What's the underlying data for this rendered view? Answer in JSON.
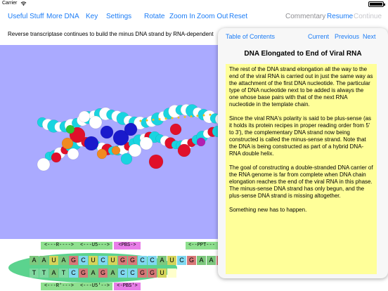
{
  "status": {
    "carrier": "Carrier",
    "time": "",
    "battery": ""
  },
  "toolbar": {
    "useful_stuff": "Useful Stuff",
    "more_dna": "More DNA",
    "key": "Key",
    "settings": "Settings",
    "rotate": "Rotate",
    "zoom_in": "Zoom In",
    "zoom_out": "Zoom Out",
    "reset": "Reset",
    "commentary": "Commentary",
    "resume": "Resume",
    "continue": "Continue"
  },
  "caption": "Reverse transcriptase continues to build the minus DNA strand by RNA-dependent",
  "popover": {
    "nav": {
      "toc": "Table of Contents",
      "current": "Current",
      "previous": "Previous",
      "next": "Next"
    },
    "title": "DNA Elongated to End of Viral RNA",
    "paragraphs": [
      "The rest of the DNA strand elongation all the way to the end of the viral RNA is carried out in just the same way as the attachment of the first DNA nucleotide. The particular type of DNA nucleotide next to be added is always the one whose base pairs with that of the next RNA nucleotide in the template chain.",
      "Since the viral RNA's polarity is said to be plus-sense (as it holds its protein recipes in proper reading order from 5' to 3'), the complementary DNA strand now being constructed is called the minus-sense strand. Note that the DNA is being constructed as part of a hybrid DNA-RNA double helix.",
      "The goal of constructing a double-stranded DNA carrier of the RNA genome is far from complete when DNA chain elongation reaches the end of the viral RNA in this phase. The minus-sense DNA strand has only begun, and the plus-sense DNA strand is missing altogether.",
      "Something new has to happen."
    ]
  },
  "sequence": {
    "top_tags": [
      {
        "label": "<---R---->",
        "color": "#8fe08f"
      },
      {
        "label": "<---U5--->",
        "color": "#8fe08f"
      },
      {
        "label": "<PBS->",
        "color": "#e87ee8"
      },
      {
        "label": "<--PPT---",
        "color": "#8fe08f"
      }
    ],
    "bottom_tags": [
      {
        "label": "<---R'--->",
        "color": "#8fe08f"
      },
      {
        "label": "<---U5'-->",
        "color": "#8fe08f"
      },
      {
        "label": "<-PBS'>",
        "color": "#e87ee8"
      }
    ],
    "rna": [
      {
        "b": "A",
        "c": "#7ec87e"
      },
      {
        "b": "A",
        "c": "#7ec87e"
      },
      {
        "b": "U",
        "c": "#d4d45a"
      },
      {
        "b": "A",
        "c": "#7ec87e"
      },
      {
        "b": "G",
        "c": "#d87878"
      },
      {
        "b": "C",
        "c": "#80d8f0"
      },
      {
        "b": "U",
        "c": "#d4d45a"
      },
      {
        "b": "C",
        "c": "#80d8f0"
      },
      {
        "b": "U",
        "c": "#d4d45a"
      },
      {
        "b": "G",
        "c": "#d87878"
      },
      {
        "b": "G",
        "c": "#d87878"
      },
      {
        "b": "C",
        "c": "#80d8f0"
      },
      {
        "b": "C",
        "c": "#80d8f0"
      },
      {
        "b": "A",
        "c": "#7ec87e"
      },
      {
        "b": "U",
        "c": "#d4d45a"
      },
      {
        "b": "C",
        "c": "#80d8f0"
      },
      {
        "b": "G",
        "c": "#d87878"
      },
      {
        "b": "A",
        "c": "#7ec87e"
      },
      {
        "b": "A",
        "c": "#7ec87e"
      },
      {
        "b": "G",
        "c": "#d87878"
      }
    ],
    "dna": [
      {
        "b": "T",
        "c": "#80d8a0"
      },
      {
        "b": "T",
        "c": "#80d8a0"
      },
      {
        "b": "A",
        "c": "#7ec87e"
      },
      {
        "b": "T",
        "c": "#80d8a0"
      },
      {
        "b": "C",
        "c": "#80d8f0"
      },
      {
        "b": "G",
        "c": "#d87878"
      },
      {
        "b": "A",
        "c": "#7ec87e"
      },
      {
        "b": "G",
        "c": "#d87878"
      },
      {
        "b": "A",
        "c": "#7ec87e"
      },
      {
        "b": "C",
        "c": "#80d8f0"
      },
      {
        "b": "C",
        "c": "#80d8f0"
      },
      {
        "b": "G",
        "c": "#d87878"
      },
      {
        "b": "G",
        "c": "#d87878"
      },
      {
        "b": "U",
        "c": "#d4d45a"
      },
      {
        "b": "",
        "c": "#ffffcc"
      }
    ]
  }
}
